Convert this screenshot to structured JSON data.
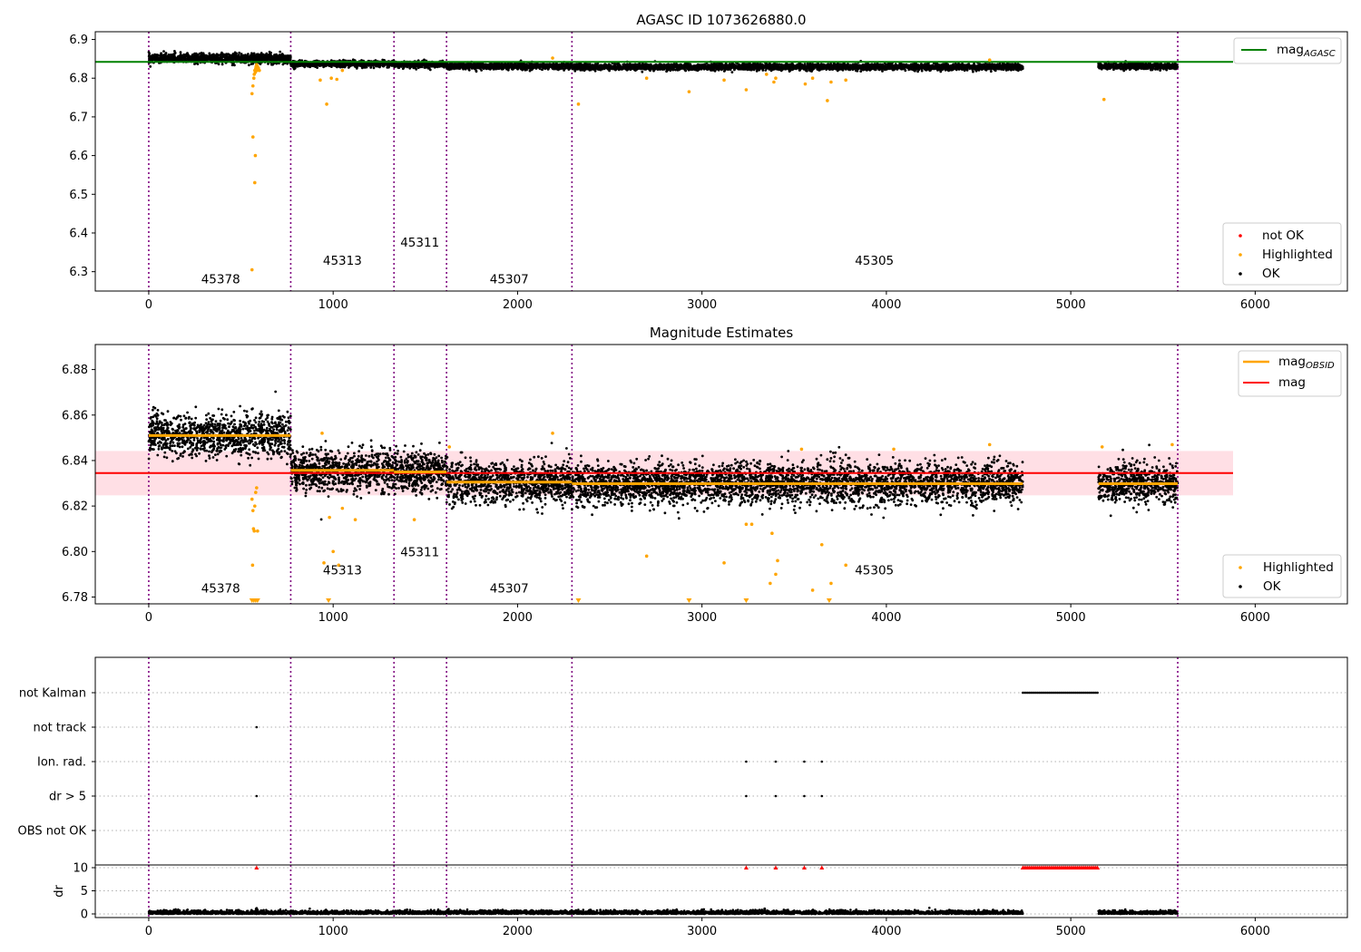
{
  "colors": {
    "ok": "#000000",
    "highlighted": "#ffa500",
    "not_ok": "#ff0000",
    "agasc_line": "#008000",
    "obsid_mag": "#ffa500",
    "mag_line": "#ff0000",
    "mag_band": "#ffc0cb",
    "obsid_boundary": "#800080",
    "flag_grid": "#b0b0b0"
  },
  "obsid_boundaries": [
    0,
    770,
    1330,
    1615,
    2295,
    5580
  ],
  "chart_data": [
    {
      "type": "scatter",
      "title": "AGASC ID 1073626880.0",
      "xlim": [
        -290,
        6500
      ],
      "ylim": [
        6.25,
        6.92
      ],
      "x_ticks": [
        0,
        1000,
        2000,
        3000,
        4000,
        5000,
        6000
      ],
      "y_ticks": [
        6.3,
        6.4,
        6.5,
        6.6,
        6.7,
        6.8,
        6.9
      ],
      "x_tick_labels": [
        "0",
        "1000",
        "2000",
        "3000",
        "4000",
        "5000",
        "6000"
      ],
      "y_tick_labels": [
        "6.3",
        "6.4",
        "6.5",
        "6.6",
        "6.7",
        "6.8",
        "6.9"
      ],
      "legend_lines": [
        {
          "label": "mag",
          "sub": "AGASC"
        }
      ],
      "legend_points": [
        "not OK",
        "Highlighted",
        "OK"
      ],
      "lines": [
        {
          "name": "mag_AGASC",
          "y": 6.842,
          "x": [
            0,
            5880
          ]
        }
      ],
      "ok_segments": [
        {
          "x": [
            0,
            770
          ],
          "mean": 6.851,
          "spread": 0.006
        },
        {
          "x": [
            770,
            1330
          ],
          "mean": 6.837,
          "spread": 0.004
        },
        {
          "x": [
            1330,
            1615
          ],
          "mean": 6.835,
          "spread": 0.004
        },
        {
          "x": [
            1615,
            2295
          ],
          "mean": 6.831,
          "spread": 0.004
        },
        {
          "x": [
            2295,
            4740
          ],
          "mean": 6.829,
          "spread": 0.004
        },
        {
          "x": [
            5150,
            5580
          ],
          "mean": 6.831,
          "spread": 0.004
        }
      ],
      "highlighted_points": [
        [
          560,
          6.76
        ],
        [
          565,
          6.78
        ],
        [
          570,
          6.8
        ],
        [
          572,
          6.81
        ],
        [
          575,
          6.82
        ],
        [
          578,
          6.815
        ],
        [
          580,
          6.825
        ],
        [
          582,
          6.83
        ],
        [
          585,
          6.835
        ],
        [
          588,
          6.82
        ],
        [
          590,
          6.83
        ],
        [
          595,
          6.826
        ],
        [
          600,
          6.82
        ],
        [
          565,
          6.648
        ],
        [
          578,
          6.6
        ],
        [
          575,
          6.53
        ],
        [
          560,
          6.305
        ],
        [
          930,
          6.795
        ],
        [
          965,
          6.733
        ],
        [
          990,
          6.8
        ],
        [
          1020,
          6.797
        ],
        [
          1050,
          6.82
        ],
        [
          2190,
          6.852
        ],
        [
          2330,
          6.733
        ],
        [
          2700,
          6.8
        ],
        [
          2930,
          6.765
        ],
        [
          3120,
          6.795
        ],
        [
          3240,
          6.77
        ],
        [
          3350,
          6.81
        ],
        [
          3390,
          6.79
        ],
        [
          3400,
          6.8
        ],
        [
          3560,
          6.785
        ],
        [
          3600,
          6.8
        ],
        [
          3680,
          6.742
        ],
        [
          3700,
          6.79
        ],
        [
          3780,
          6.795
        ],
        [
          5180,
          6.745
        ],
        [
          4560,
          6.847
        ]
      ],
      "obsid_labels": [
        {
          "text": "45378",
          "x": 390,
          "y": 6.27
        },
        {
          "text": "45313",
          "x": 1050,
          "y": 6.318
        },
        {
          "text": "45311",
          "x": 1470,
          "y": 6.365
        },
        {
          "text": "45307",
          "x": 1955,
          "y": 6.27
        },
        {
          "text": "45305",
          "x": 3935,
          "y": 6.318
        }
      ]
    },
    {
      "type": "scatter",
      "title": "Magnitude Estimates",
      "xlim": [
        -290,
        6500
      ],
      "ylim": [
        6.777,
        6.891
      ],
      "x_ticks": [
        0,
        1000,
        2000,
        3000,
        4000,
        5000,
        6000
      ],
      "y_ticks": [
        6.78,
        6.8,
        6.82,
        6.84,
        6.86,
        6.88
      ],
      "x_tick_labels": [
        "0",
        "1000",
        "2000",
        "3000",
        "4000",
        "5000",
        "6000"
      ],
      "y_tick_labels": [
        "6.78",
        "6.80",
        "6.82",
        "6.84",
        "6.86",
        "6.88"
      ],
      "legend_lines": [
        {
          "label": "mag",
          "sub": "OBSID"
        },
        {
          "label": "mag",
          "sub": ""
        }
      ],
      "legend_points": [
        "Highlighted",
        "OK"
      ],
      "mag": {
        "y": 6.8345,
        "band": [
          6.8247,
          6.8442
        ],
        "x": [
          0,
          5880
        ]
      },
      "obsid_mag_segments": [
        {
          "x": [
            0,
            770
          ],
          "y": 6.851
        },
        {
          "x": [
            770,
            1330
          ],
          "y": 6.8357
        },
        {
          "x": [
            1330,
            1615
          ],
          "y": 6.835
        },
        {
          "x": [
            1615,
            2295
          ],
          "y": 6.8305
        },
        {
          "x": [
            2295,
            4740
          ],
          "y": 6.8298
        },
        {
          "x": [
            5150,
            5580
          ],
          "y": 6.8298
        }
      ],
      "ok_segments": [
        {
          "x": [
            0,
            770
          ],
          "mean": 6.851,
          "spread": 0.0045
        },
        {
          "x": [
            770,
            1330
          ],
          "mean": 6.8357,
          "spread": 0.0045
        },
        {
          "x": [
            1330,
            1615
          ],
          "mean": 6.835,
          "spread": 0.0045
        },
        {
          "x": [
            1615,
            2295
          ],
          "mean": 6.8305,
          "spread": 0.0045
        },
        {
          "x": [
            2295,
            4740
          ],
          "mean": 6.8298,
          "spread": 0.0045
        },
        {
          "x": [
            5150,
            5580
          ],
          "mean": 6.8298,
          "spread": 0.0045
        }
      ],
      "highlighted_points": [
        [
          560,
          6.823
        ],
        [
          565,
          6.818
        ],
        [
          568,
          6.81
        ],
        [
          572,
          6.809
        ],
        [
          575,
          6.82
        ],
        [
          580,
          6.826
        ],
        [
          585,
          6.828
        ],
        [
          590,
          6.809
        ],
        [
          563,
          6.794
        ],
        [
          940,
          6.852
        ],
        [
          950,
          6.795
        ],
        [
          980,
          6.815
        ],
        [
          1000,
          6.8
        ],
        [
          1030,
          6.794
        ],
        [
          1050,
          6.819
        ],
        [
          1120,
          6.814
        ],
        [
          1440,
          6.814
        ],
        [
          1630,
          6.846
        ],
        [
          2190,
          6.852
        ],
        [
          2700,
          6.798
        ],
        [
          3120,
          6.795
        ],
        [
          3240,
          6.812
        ],
        [
          3270,
          6.812
        ],
        [
          3370,
          6.786
        ],
        [
          3380,
          6.808
        ],
        [
          3400,
          6.79
        ],
        [
          3410,
          6.796
        ],
        [
          3540,
          6.845
        ],
        [
          3600,
          6.783
        ],
        [
          3650,
          6.803
        ],
        [
          3700,
          6.786
        ],
        [
          3780,
          6.794
        ],
        [
          4040,
          6.845
        ],
        [
          4560,
          6.847
        ],
        [
          5170,
          6.846
        ],
        [
          5550,
          6.847
        ]
      ],
      "below_range_markers": [
        560,
        570,
        580,
        590,
        975,
        2330,
        2930,
        3240,
        3690
      ],
      "obsid_labels": [
        {
          "text": "45378",
          "x": 390,
          "y": 6.782
        },
        {
          "text": "45313",
          "x": 1050,
          "y": 6.79
        },
        {
          "text": "45311",
          "x": 1470,
          "y": 6.798
        },
        {
          "text": "45307",
          "x": 1955,
          "y": 6.782
        },
        {
          "text": "45305",
          "x": 3935,
          "y": 6.79
        }
      ]
    },
    {
      "type": "scatter",
      "title": "",
      "xlim": [
        -290,
        6500
      ],
      "categories": [
        "not Kalman",
        "not track",
        "Ion. rad.",
        "dr > 5",
        "OBS not OK"
      ],
      "flags": {
        "not Kalman": [
          [
            4740,
            5150
          ]
        ],
        "not track": [
          [
            585,
            585
          ]
        ],
        "Ion. rad.": [
          [
            3240,
            3240
          ],
          [
            3400,
            3400
          ],
          [
            3555,
            3555
          ],
          [
            3650,
            3650
          ]
        ],
        "dr > 5": [
          [
            585,
            585
          ],
          [
            3240,
            3240
          ],
          [
            3400,
            3400
          ],
          [
            3555,
            3555
          ],
          [
            3650,
            3650
          ]
        ],
        "OBS not OK": []
      }
    },
    {
      "type": "scatter",
      "title": "",
      "xlim": [
        -290,
        6500
      ],
      "ylim": [
        -0.3,
        10.5
      ],
      "ylabel": "dr",
      "x_ticks": [
        0,
        1000,
        2000,
        3000,
        4000,
        5000,
        6000
      ],
      "y_ticks": [
        0,
        5,
        10
      ],
      "x_tick_labels": [
        "0",
        "1000",
        "2000",
        "3000",
        "4000",
        "5000",
        "6000"
      ],
      "y_tick_labels": [
        "0",
        "5",
        "10"
      ],
      "ok_segments": [
        {
          "x": [
            0,
            4740
          ],
          "mean": 0.25,
          "spread": 0.25
        },
        {
          "x": [
            5150,
            5580
          ],
          "mean": 0.25,
          "spread": 0.25
        }
      ],
      "high_points": [
        [
          585,
          1.2
        ],
        [
          590,
          0.8
        ],
        [
          3000,
          0.9
        ],
        [
          3340,
          1.1
        ]
      ],
      "clipped_markers": {
        "y": 10,
        "x_single": [
          585,
          3240,
          3400,
          3555,
          3650
        ],
        "x_range": [
          4740,
          5150
        ]
      }
    }
  ]
}
